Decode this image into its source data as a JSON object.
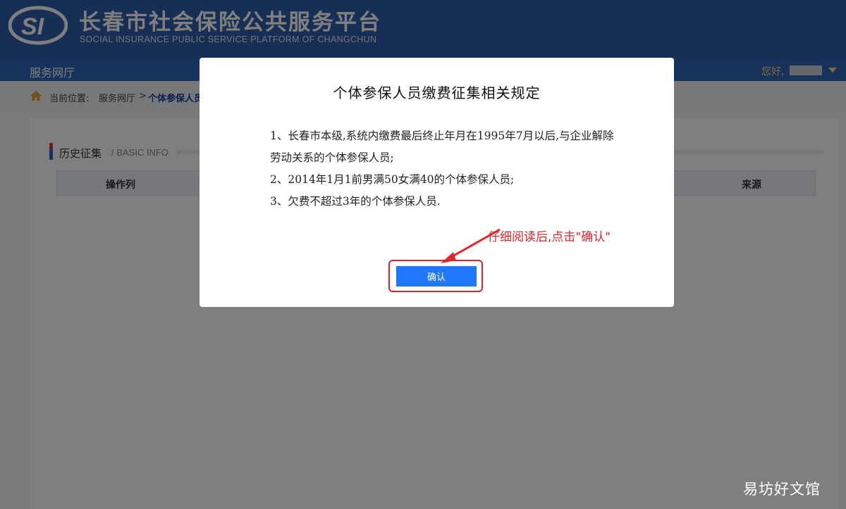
{
  "header": {
    "title": "长春市社会保险公共服务平台",
    "subtitle": "SOCIAL INSURANCE PUBLIC SERVICE PLATFORM OF CHANGCHUN",
    "logo_icon": "si-logo"
  },
  "nav": {
    "title": "服务网厅",
    "greeting": "您好,"
  },
  "breadcrumb": {
    "label": "当前位置:",
    "home": "服务网厅",
    "separator": ">",
    "current": "个体参保人员"
  },
  "section": {
    "title": "历史征集",
    "subtitle": "/ BASIC INFO"
  },
  "table": {
    "headers": [
      "操作列",
      "来源"
    ]
  },
  "modal": {
    "title": "个体参保人员缴费征集相关规定",
    "items": [
      "1、长春市本级,系统内缴费最后终止年月在1995年7月以后,与企业解除劳动关系的个体参保人员;",
      "2、2014年1月1前男满50女满40的个体参保人员;",
      "3、欠费不超过3年的个体参保人员."
    ],
    "confirm_label": "确认",
    "annotation": "仔细阅读后,点击\"确认\""
  },
  "watermark": "易坊好文馆",
  "colors": {
    "header_bg": "#2f5fa8",
    "nav_bg": "#2f64b6",
    "confirm_bg": "#1f78ff",
    "annotation": "#e0262b"
  }
}
